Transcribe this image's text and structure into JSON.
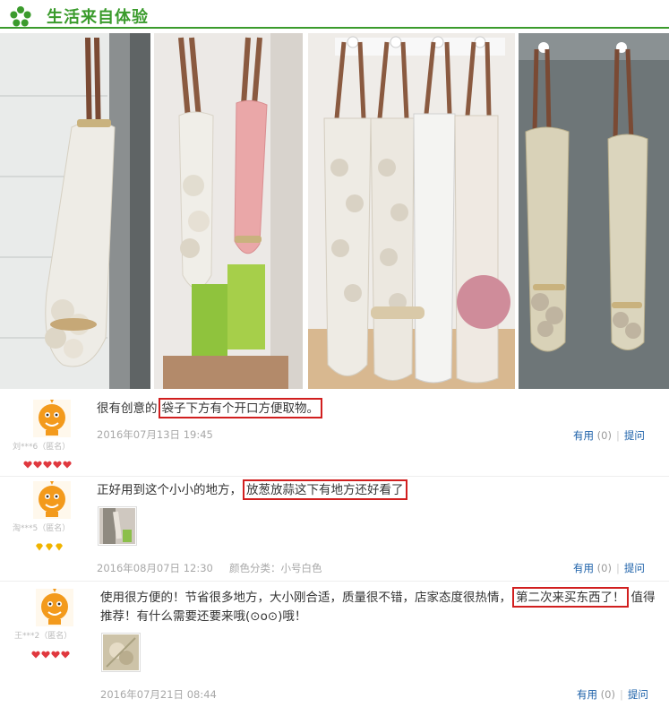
{
  "header": {
    "title": "生活来自体验",
    "logo_icon": "green-flower-icon",
    "accent": "#3a9b2c"
  },
  "reviews": [
    {
      "username": "刘***6（匿名）",
      "rank_icons": 5,
      "rank_color": "#e0383e",
      "text_prefix": "很有创意的",
      "text_highlight": "袋子下方有个开口方便取物。",
      "text_suffix": "",
      "date": "2016年07月13日 19:45",
      "variant": "",
      "useful_label": "有用",
      "useful_count": "(0)",
      "ask_label": "提问"
    },
    {
      "username": "淘***5（匿名）",
      "rank_icons": 3,
      "rank_color": "#f0b400",
      "text_prefix": "正好用到这个小小的地方，",
      "text_highlight": "放葱放蒜这下有地方还好看了",
      "text_suffix": "",
      "date": "2016年08月07日 12:30",
      "variant": "颜色分类：小号白色",
      "useful_label": "有用",
      "useful_count": "(0)",
      "ask_label": "提问"
    },
    {
      "username": "王***2（匿名）",
      "rank_icons": 4,
      "rank_color": "#e0383e",
      "text_line1_prefix": "使用很方便的！节省很多地方，大小刚合适，质量很不错，店家态度很热情，",
      "text_highlight": "第二次来买东西了！",
      "text_line1_suffix": "值得",
      "text_line2": "推荐！有什么需要还要来哦(⊙o⊙)哦！",
      "date": "2016年07月21日 08:44",
      "variant": "",
      "useful_label": "有用",
      "useful_count": "(0)",
      "ask_label": "提问"
    }
  ]
}
